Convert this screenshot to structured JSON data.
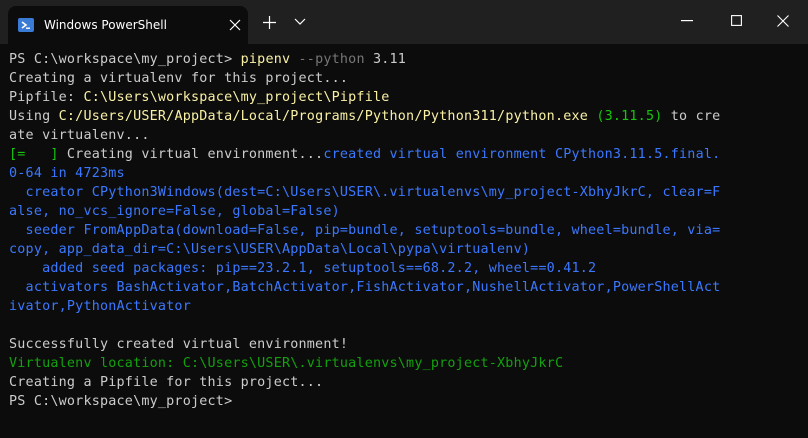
{
  "window": {
    "tab_title": "Windows PowerShell",
    "icons": {
      "tab_icon": "powershell-icon",
      "close": "close-icon",
      "new_tab": "plus-icon",
      "dropdown": "chevron-down-icon",
      "minimize": "minimize-icon",
      "maximize": "maximize-icon",
      "window_close": "close-icon"
    },
    "colors": {
      "background": "#0c0c0c",
      "titlebar": "#202020",
      "text": "#cccccc",
      "yellow": "#f9f1a5",
      "green": "#16c60c",
      "dark_green": "#13a10e",
      "blue": "#3b78ff",
      "gray": "#767676"
    }
  },
  "terminal": {
    "lines": [
      {
        "segments": [
          {
            "t": "PS C:\\workspace\\my_project> ",
            "c": "white"
          },
          {
            "t": "pipenv",
            "c": "yellow"
          },
          {
            "t": " --python",
            "c": "gray"
          },
          {
            "t": " 3.11",
            "c": "white"
          }
        ]
      },
      {
        "segments": [
          {
            "t": "Creating a virtualenv for this project...",
            "c": "white"
          }
        ]
      },
      {
        "segments": [
          {
            "t": "Pipfile: ",
            "c": "white"
          },
          {
            "t": "C:\\Users\\workspace\\my_project\\Pipfile",
            "c": "yellow"
          }
        ]
      },
      {
        "segments": [
          {
            "t": "Using ",
            "c": "white"
          },
          {
            "t": "C:/Users/USER/AppData/Local/Programs/Python/Python311/python.exe",
            "c": "yellow"
          },
          {
            "t": " (3.11.5)",
            "c": "green"
          },
          {
            "t": " to cre",
            "c": "white"
          }
        ]
      },
      {
        "segments": [
          {
            "t": "ate virtualenv...",
            "c": "white"
          }
        ]
      },
      {
        "segments": [
          {
            "t": "[=   ] ",
            "c": "green"
          },
          {
            "t": "Creating virtual environment...",
            "c": "white"
          },
          {
            "t": "created virtual environment CPython3.11.5.final.",
            "c": "blue"
          }
        ]
      },
      {
        "segments": [
          {
            "t": "0-64 in 4723ms",
            "c": "blue"
          }
        ]
      },
      {
        "segments": [
          {
            "t": "  creator CPython3Windows(dest=C:\\Users\\USER\\.virtualenvs\\my_project-XbhyJkrC, clear=F",
            "c": "blue"
          }
        ]
      },
      {
        "segments": [
          {
            "t": "alse, no_vcs_ignore=False, global=False)",
            "c": "blue"
          }
        ]
      },
      {
        "segments": [
          {
            "t": "  seeder FromAppData(download=False, pip=bundle, setuptools=bundle, wheel=bundle, via=",
            "c": "blue"
          }
        ]
      },
      {
        "segments": [
          {
            "t": "copy, app_data_dir=C:\\Users\\USER\\AppData\\Local\\pypa\\virtualenv)",
            "c": "blue"
          }
        ]
      },
      {
        "segments": [
          {
            "t": "    added seed packages: pip==23.2.1, setuptools==68.2.2, wheel==0.41.2",
            "c": "blue"
          }
        ]
      },
      {
        "segments": [
          {
            "t": "  activators BashActivator,BatchActivator,FishActivator,NushellActivator,PowerShellAct",
            "c": "blue"
          }
        ]
      },
      {
        "segments": [
          {
            "t": "ivator,PythonActivator",
            "c": "blue"
          }
        ]
      },
      {
        "segments": [
          {
            "t": "",
            "c": "white"
          }
        ]
      },
      {
        "segments": [
          {
            "t": "Successfully created virtual environment!",
            "c": "white"
          }
        ]
      },
      {
        "segments": [
          {
            "t": "Virtualenv location: C:\\Users\\USER\\.virtualenvs\\my_project-XbhyJkrC",
            "c": "darkgreen"
          }
        ]
      },
      {
        "segments": [
          {
            "t": "Creating a Pipfile for this project...",
            "c": "white"
          }
        ]
      },
      {
        "segments": [
          {
            "t": "PS C:\\workspace\\my_project>",
            "c": "white"
          }
        ]
      }
    ]
  }
}
